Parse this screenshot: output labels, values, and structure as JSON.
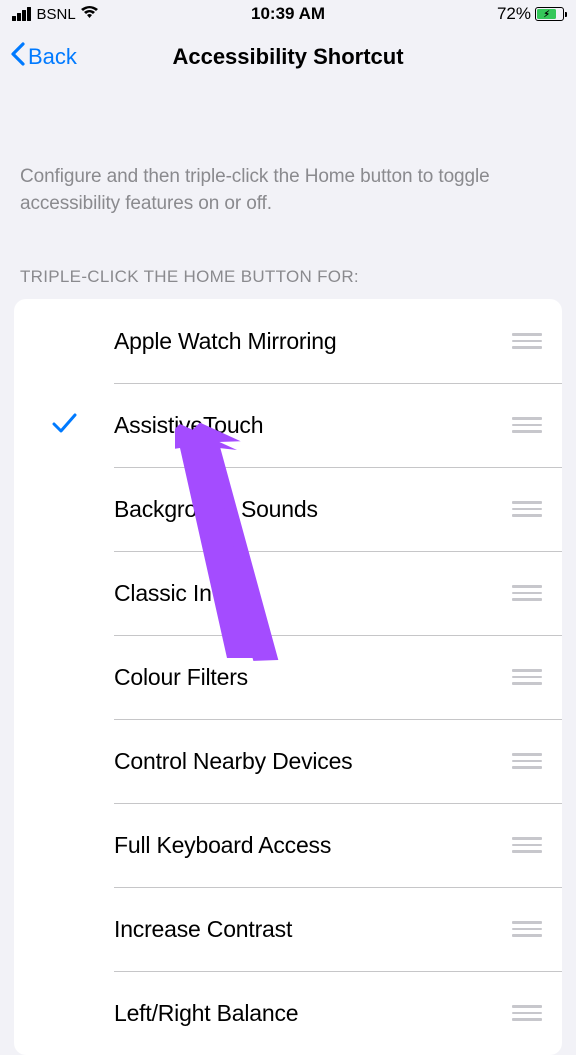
{
  "statusBar": {
    "carrier": "BSNL",
    "time": "10:39 AM",
    "battery": "72%"
  },
  "nav": {
    "back": "Back",
    "title": "Accessibility Shortcut"
  },
  "description": "Configure and then triple-click the Home button to toggle accessibility features on or off.",
  "sectionHeader": "TRIPLE-CLICK THE HOME BUTTON FOR:",
  "items": [
    {
      "label": "Apple Watch Mirroring",
      "checked": false
    },
    {
      "label": "AssistiveTouch",
      "checked": true
    },
    {
      "label": "Background Sounds",
      "checked": false
    },
    {
      "label": "Classic Invert",
      "checked": false
    },
    {
      "label": "Colour Filters",
      "checked": false
    },
    {
      "label": "Control Nearby Devices",
      "checked": false
    },
    {
      "label": "Full Keyboard Access",
      "checked": false
    },
    {
      "label": "Increase Contrast",
      "checked": false
    },
    {
      "label": "Left/Right Balance",
      "checked": false
    }
  ],
  "colors": {
    "accent": "#007aff",
    "arrow": "#a44cff"
  }
}
